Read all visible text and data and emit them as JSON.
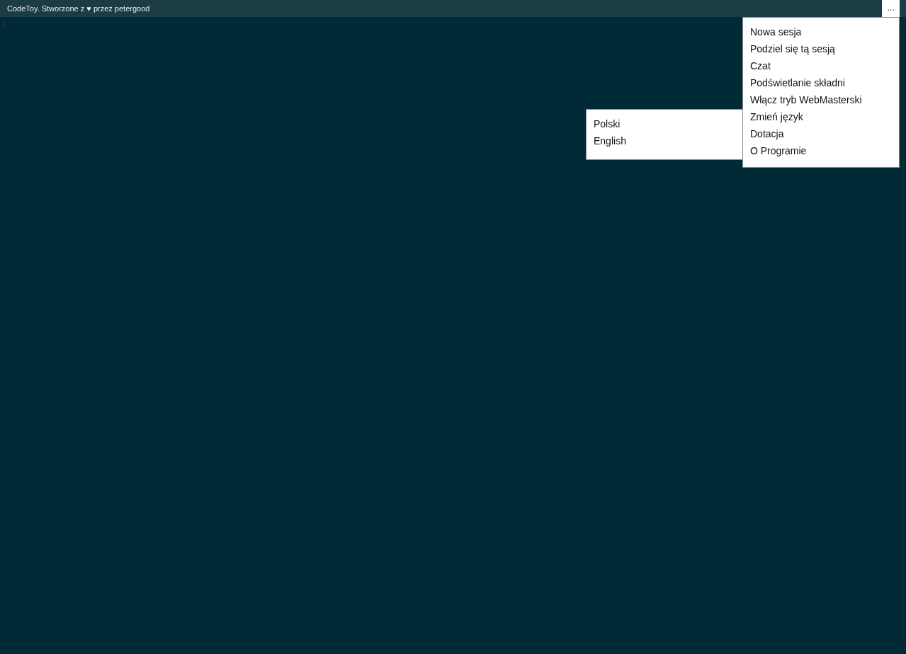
{
  "title_bar": {
    "title": "CodeToy. Stworzone z ♥ przez petergood",
    "menu_button": "..."
  },
  "menu": {
    "items": [
      {
        "label": "Nowa sesja"
      },
      {
        "label": "Podziel się tą sesją"
      },
      {
        "label": "Czat"
      },
      {
        "label": "Podświetlanie składni"
      },
      {
        "label": "Włącz tryb WebMasterski"
      },
      {
        "label": "Zmień język"
      },
      {
        "label": "Dotacja"
      },
      {
        "label": "O Programie"
      }
    ]
  },
  "language_submenu": {
    "items": [
      {
        "label": "Polski"
      },
      {
        "label": "English"
      }
    ]
  }
}
